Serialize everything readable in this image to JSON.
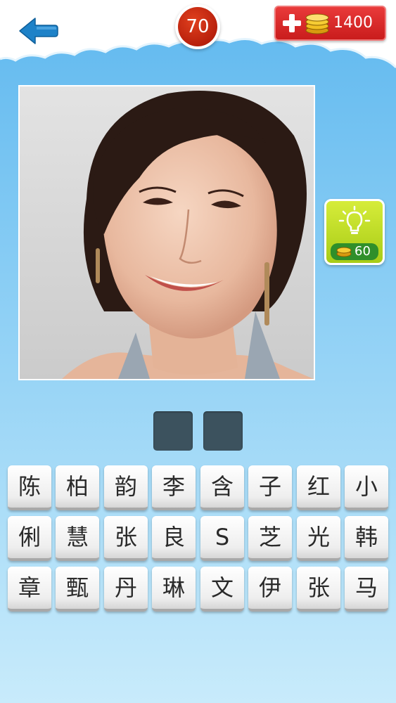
{
  "header": {
    "back_icon": "back-arrow-icon",
    "level": "70",
    "coins": {
      "plus_icon": "plus-icon",
      "coin_icon": "coin-stack-icon",
      "count": "1400"
    }
  },
  "puzzle": {
    "image_subject": "portrait-photo"
  },
  "hint": {
    "icon": "lightbulb-icon",
    "coin_icon": "coin-icon",
    "cost": "60"
  },
  "answer": {
    "slots": [
      "",
      ""
    ]
  },
  "letters": {
    "rows": [
      [
        "陈",
        "柏",
        "韵",
        "李",
        "含",
        "子",
        "红",
        "小"
      ],
      [
        "俐",
        "慧",
        "张",
        "良",
        "S",
        "芝",
        "光",
        "韩"
      ],
      [
        "章",
        "甄",
        "丹",
        "琳",
        "文",
        "伊",
        "张",
        "马"
      ]
    ]
  },
  "colors": {
    "background_top": "#5fb8ef",
    "background_bottom": "#c8ebfb",
    "level_badge": "#c42a10",
    "coins_button": "#d82626",
    "hint_button": "#bfe02a",
    "answer_slot": "#3c525e",
    "back_arrow": "#1e82c8"
  }
}
